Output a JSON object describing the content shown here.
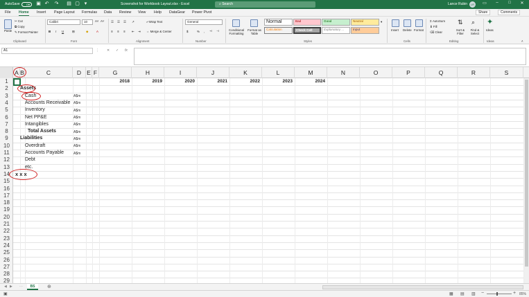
{
  "title_bar": {
    "autosave_label": "AutoSave",
    "autosave_state": "Off",
    "title": "Screenshot for Workbook Layout.xlsx - Excel",
    "search_placeholder": "Search",
    "user_name": "Lance Rubin",
    "user_initials": "LR",
    "accent": "#217346"
  },
  "menu": {
    "tabs": [
      "File",
      "Home",
      "Insert",
      "Page Layout",
      "Formulas",
      "Data",
      "Review",
      "View",
      "Help",
      "DataGear",
      "Power Pivot"
    ],
    "active": "Home",
    "share_label": "Share",
    "comments_label": "Comments"
  },
  "ribbon": {
    "clipboard": {
      "paste": "Paste",
      "cut": "Cut",
      "copy": "Copy",
      "format_painter": "Format Painter",
      "group": "Clipboard"
    },
    "font": {
      "name": "Calibri",
      "size": "10",
      "bold": "B",
      "italic": "I",
      "underline": "U",
      "group": "Font"
    },
    "alignment": {
      "wrap": "Wrap Text",
      "merge": "Merge & Center",
      "group": "Alignment"
    },
    "number": {
      "format": "General",
      "dollar": "$",
      "percent": "%",
      "comma": ",",
      "group": "Number"
    },
    "styles": {
      "conditional": "Conditional Formatting",
      "format_table": "Format as Table",
      "normal": "Normal",
      "bad": "Bad",
      "good": "Good",
      "neutral": "Neutral",
      "calculation": "Calculation",
      "check_cell": "Check Cell",
      "explanatory": "Explanatory ...",
      "input": "Input",
      "group": "Styles"
    },
    "cells": {
      "insert": "Insert",
      "delete": "Delete",
      "format": "Format",
      "group": "Cells"
    },
    "editing": {
      "autosum": "AutoSum",
      "fill": "Fill",
      "clear": "Clear",
      "sort": "Sort & Filter",
      "find": "Find & Select",
      "group": "Editing"
    },
    "ideas": {
      "label": "Ideas",
      "group": "Ideas"
    }
  },
  "formula_bar": {
    "name_box": "A1",
    "fx": "fx"
  },
  "columns": [
    "A",
    "B",
    "C",
    "D",
    "E",
    "F",
    "G",
    "H",
    "I",
    "J",
    "K",
    "L",
    "M",
    "N",
    "O",
    "P",
    "Q",
    "R",
    "S"
  ],
  "rows": [
    "1",
    "2",
    "3",
    "4",
    "5",
    "6",
    "7",
    "8",
    "9",
    "10",
    "11",
    "12",
    "13",
    "14",
    "15",
    "16",
    "17",
    "18",
    "19",
    "20",
    "21",
    "22",
    "23",
    "24",
    "25",
    "26",
    "27",
    "28",
    "29"
  ],
  "years": [
    "2018",
    "2019",
    "2020",
    "2021",
    "2022",
    "2023",
    "2024"
  ],
  "cells": [
    {
      "row": 2,
      "col": "B",
      "text": "Assets",
      "bold": true
    },
    {
      "row": 3,
      "col": "C",
      "text": "Cash",
      "unit": "A$m"
    },
    {
      "row": 4,
      "col": "C",
      "text": "Accounts Receivable",
      "unit": "A$m"
    },
    {
      "row": 5,
      "col": "C",
      "text": "Inventory",
      "unit": "A$m"
    },
    {
      "row": 6,
      "col": "C",
      "text": "Net PP&E",
      "unit": "A$m"
    },
    {
      "row": 7,
      "col": "C",
      "text": "Intangibles",
      "unit": "A$m"
    },
    {
      "row": 8,
      "col": "C",
      "text": "Total Assets",
      "unit": "A$m",
      "bold": true
    },
    {
      "row": 9,
      "col": "B",
      "text": "Liabilities",
      "unit": "A$m",
      "bold": true
    },
    {
      "row": 10,
      "col": "C",
      "text": "Overdraft",
      "unit": "A$m"
    },
    {
      "row": 11,
      "col": "C",
      "text": "Accounts Payable",
      "unit": "A$m"
    },
    {
      "row": 12,
      "col": "C",
      "text": "Debt"
    },
    {
      "row": 13,
      "col": "C",
      "text": "etc."
    },
    {
      "row": 14,
      "col": "B",
      "text": "x x x",
      "bold": true
    }
  ],
  "sheet_tab": "BS",
  "zoom": "85%",
  "annotation_color": "#d22222"
}
